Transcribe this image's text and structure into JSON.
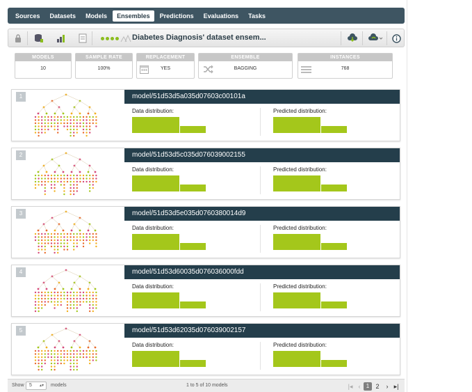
{
  "nav": {
    "tabs": [
      {
        "label": "Sources",
        "active": false
      },
      {
        "label": "Datasets",
        "active": false
      },
      {
        "label": "Models",
        "active": false
      },
      {
        "label": "Ensembles",
        "active": true
      },
      {
        "label": "Predictions",
        "active": false
      },
      {
        "label": "Evaluations",
        "active": false
      },
      {
        "label": "Tasks",
        "active": false
      }
    ]
  },
  "toolbar": {
    "title": "Diabetes Diagnosis' dataset ensem...",
    "icons": [
      "lock-icon",
      "database-icon",
      "chart-icon",
      "document-icon",
      "status-dots-icon",
      "tree-icon",
      "cloud-download-icon",
      "cloud-refresh-icon",
      "info-icon"
    ]
  },
  "summary": {
    "models": {
      "label": "MODELS",
      "value": "10"
    },
    "sample_rate": {
      "label": "SAMPLE RATE",
      "value": "100%"
    },
    "replacement": {
      "label": "REPLACEMENT",
      "value": "YES",
      "icon": "calendar-icon"
    },
    "ensemble": {
      "label": "ENSEMBLE",
      "value": "BAGGING",
      "icon": "shuffle-icon"
    },
    "instances": {
      "label": "INSTANCES",
      "value": "768",
      "icon": "list-icon"
    }
  },
  "labels": {
    "data_distribution": "Data distribution:",
    "predicted_distribution": "Predicted distribution:"
  },
  "models": [
    {
      "index": "1",
      "id": "model/51d53d5a035d07603c00101a",
      "data_dist": [
        0.65,
        0.35
      ],
      "pred_dist": [
        0.65,
        0.35
      ]
    },
    {
      "index": "2",
      "id": "model/51d53d5c035d076039002155",
      "data_dist": [
        0.65,
        0.35
      ],
      "pred_dist": [
        0.65,
        0.35
      ]
    },
    {
      "index": "3",
      "id": "model/51d53d5e035d0760380014d9",
      "data_dist": [
        0.65,
        0.35
      ],
      "pred_dist": [
        0.65,
        0.35
      ]
    },
    {
      "index": "4",
      "id": "model/51d53d60035d076036000fdd",
      "data_dist": [
        0.65,
        0.35
      ],
      "pred_dist": [
        0.65,
        0.35
      ]
    },
    {
      "index": "5",
      "id": "model/51d53d62035d076039002157",
      "data_dist": [
        0.65,
        0.35
      ],
      "pred_dist": [
        0.65,
        0.35
      ]
    }
  ],
  "colors": {
    "nav_bg": "#3e5562",
    "card_header": "#243e4b",
    "bar_green": "#a4c71b",
    "tree_node_colors": [
      "#f2b01e",
      "#d64a7a",
      "#a4c71b",
      "#e96b2c"
    ]
  },
  "footer": {
    "show_label": "Show",
    "page_size": "5",
    "models_label": "models",
    "range_text": "1 to 5 of 10 models",
    "pages": [
      "1",
      "2"
    ],
    "current_page": "1"
  }
}
